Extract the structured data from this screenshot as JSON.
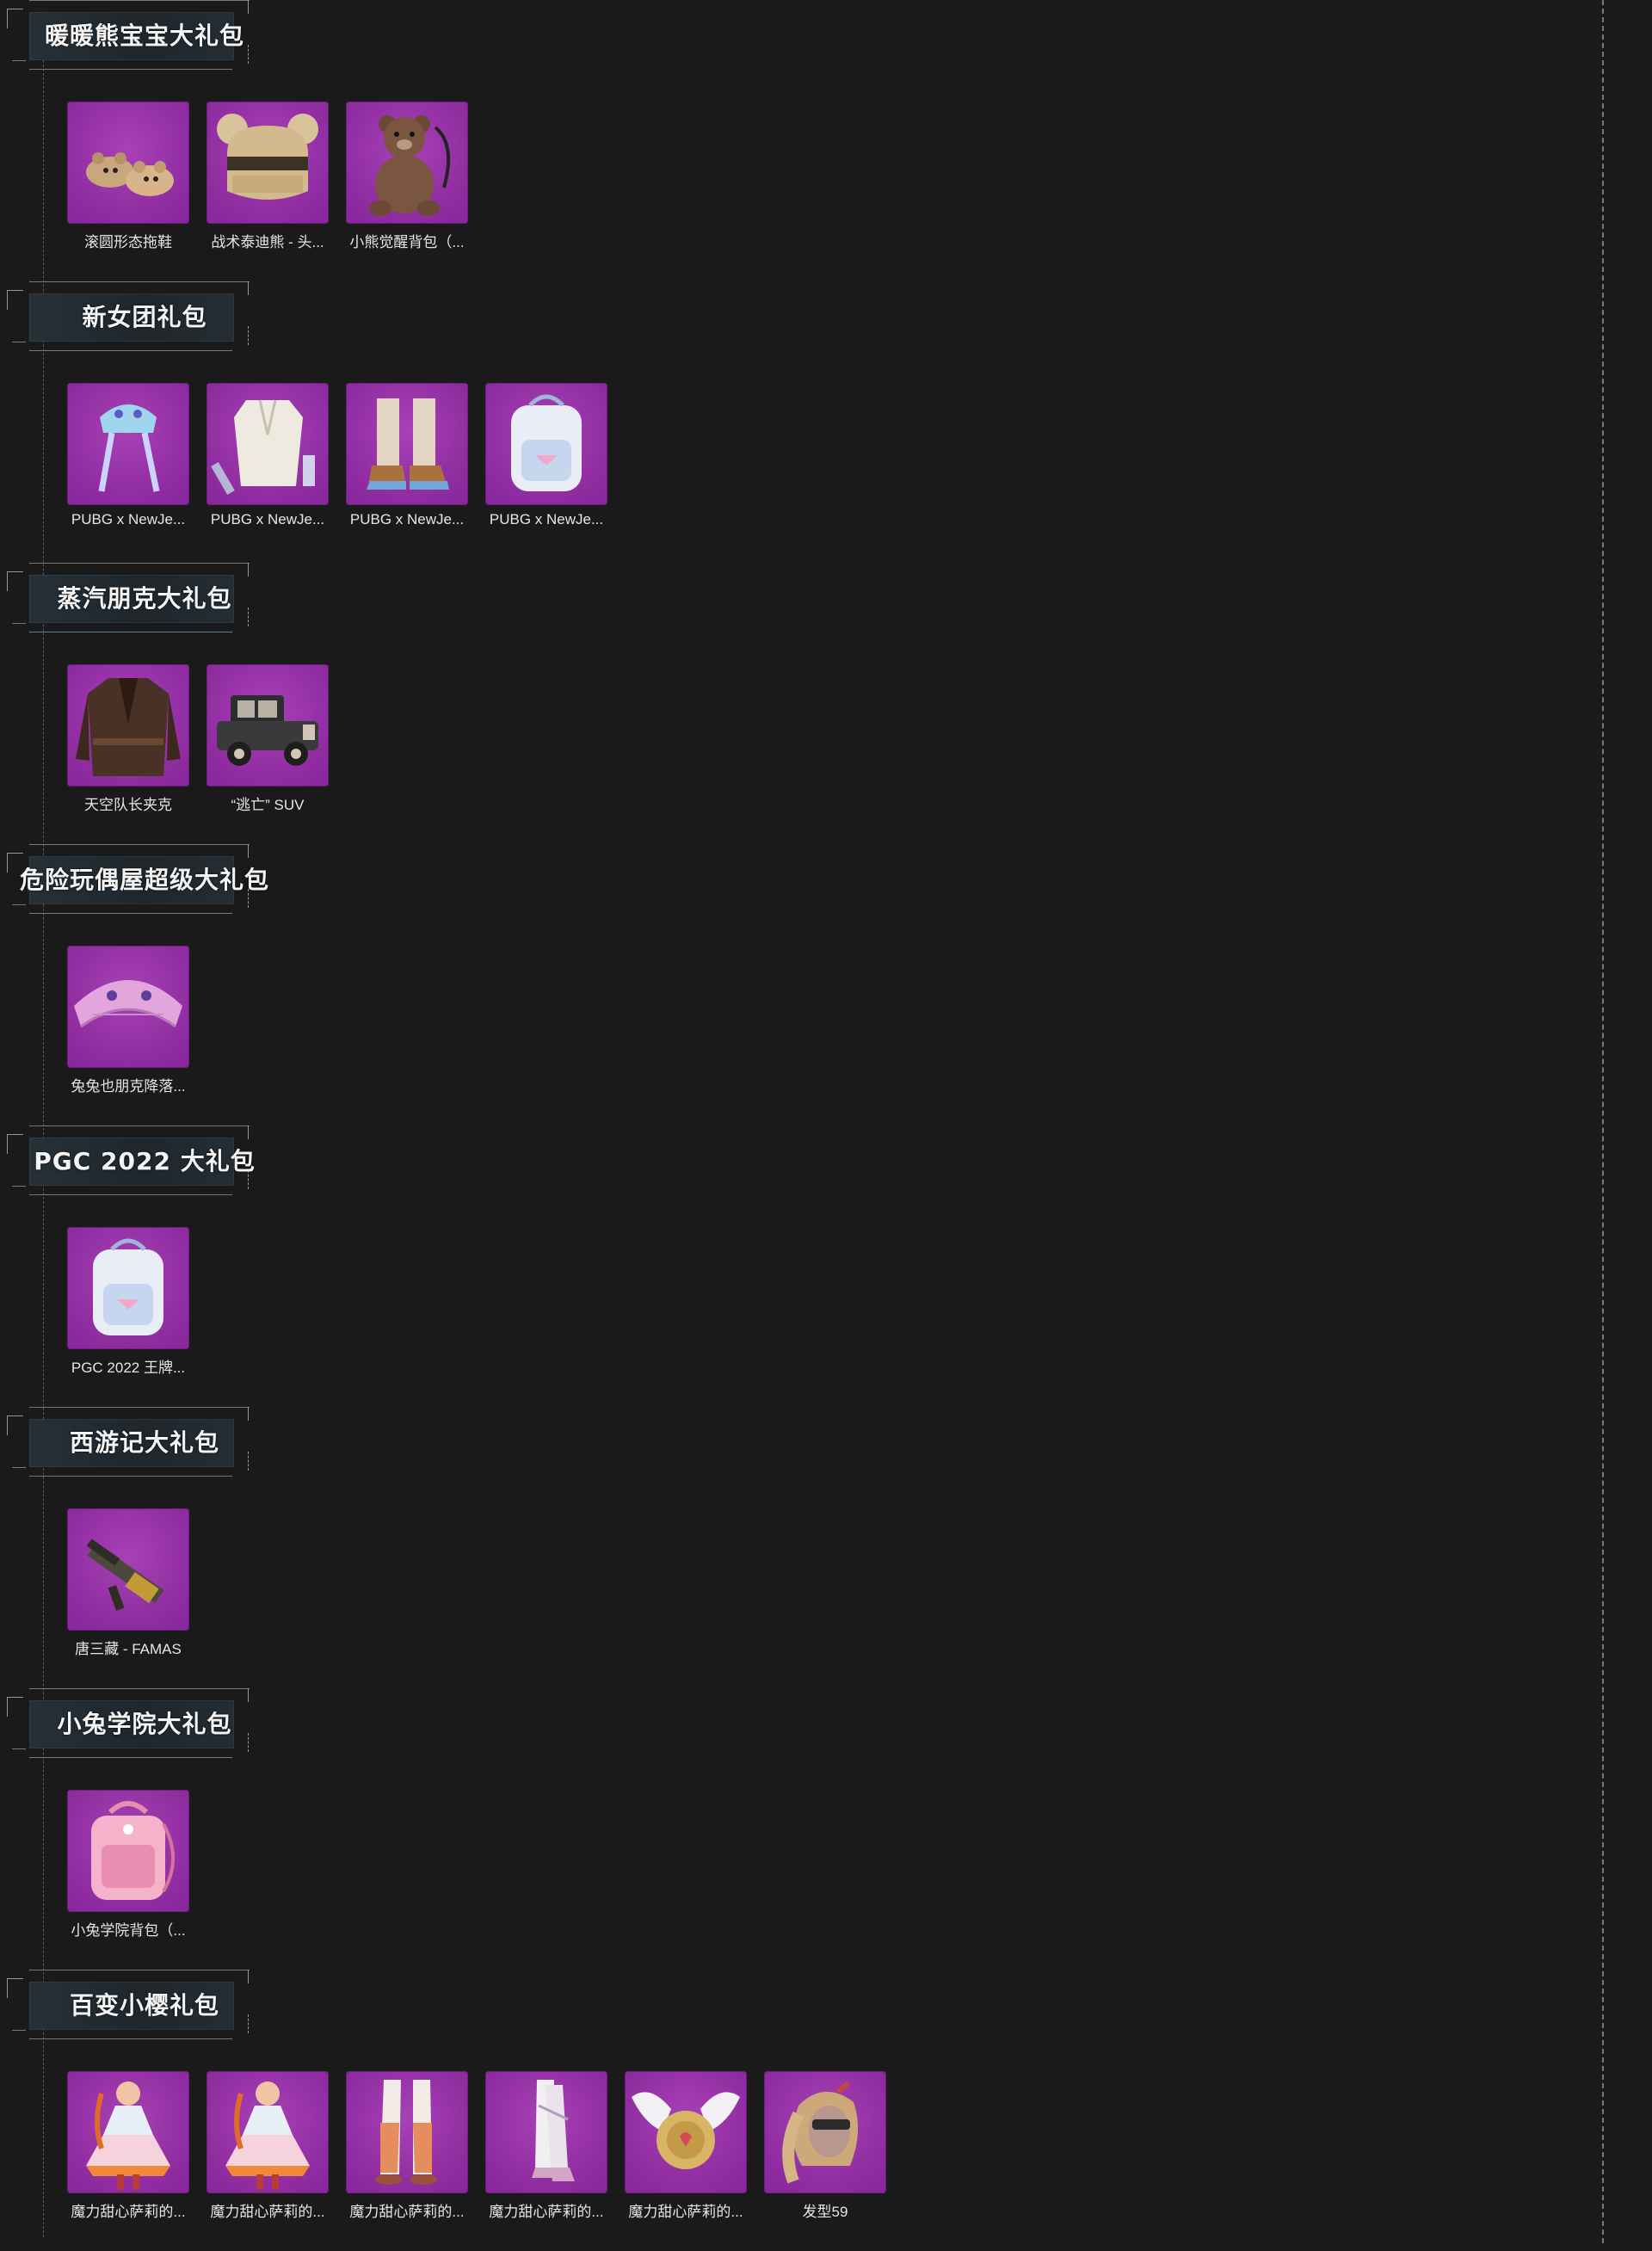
{
  "colors": {
    "background": "#1a1a1b",
    "tile": "#9b36ad",
    "header_bar": "#232c32",
    "text": "#f4f4f4"
  },
  "sections": [
    {
      "title": "暖暖熊宝宝大礼包",
      "items": [
        {
          "label": "滚圆形态拖鞋",
          "icon": "bear-slippers-icon"
        },
        {
          "label": "战术泰迪熊 - 头...",
          "icon": "teddy-helmet-icon"
        },
        {
          "label": "小熊觉醒背包（...",
          "icon": "teddy-backpack-icon"
        }
      ]
    },
    {
      "title": "新女团礼包",
      "items": [
        {
          "label": "PUBG x NewJe...",
          "icon": "hat-icon"
        },
        {
          "label": "PUBG x NewJe...",
          "icon": "outfit-icon"
        },
        {
          "label": "PUBG x NewJe...",
          "icon": "shoes-icon"
        },
        {
          "label": "PUBG x NewJe...",
          "icon": "backpack-icon"
        }
      ]
    },
    {
      "title": "蒸汽朋克大礼包",
      "items": [
        {
          "label": "天空队长夹克",
          "icon": "jacket-icon"
        },
        {
          "label": "“逃亡” SUV",
          "icon": "car-icon"
        }
      ]
    },
    {
      "title": "危险玩偶屋超级大礼包",
      "items": [
        {
          "label": "兔兔也朋克降落...",
          "icon": "parachute-icon"
        }
      ]
    },
    {
      "title": "PGC 2022 大礼包",
      "items": [
        {
          "label": "PGC 2022 王牌...",
          "icon": "backpack-icon"
        }
      ]
    },
    {
      "title": "西游记大礼包",
      "items": [
        {
          "label": "唐三藏 - FAMAS",
          "icon": "rifle-icon"
        }
      ]
    },
    {
      "title": "小兔学院大礼包",
      "items": [
        {
          "label": "小兔学院背包（...",
          "icon": "pink-backpack-icon"
        }
      ]
    },
    {
      "title": "百变小樱礼包",
      "items": [
        {
          "label": "魔力甜心萨莉的...",
          "icon": "dress-icon"
        },
        {
          "label": "魔力甜心萨莉的...",
          "icon": "dress-icon"
        },
        {
          "label": "魔力甜心萨莉的...",
          "icon": "boots-icon"
        },
        {
          "label": "魔力甜心萨莉的...",
          "icon": "stockings-icon"
        },
        {
          "label": "魔力甜心萨莉的...",
          "icon": "winged-shield-icon"
        },
        {
          "label": "发型59",
          "icon": "hair-icon"
        }
      ]
    }
  ]
}
